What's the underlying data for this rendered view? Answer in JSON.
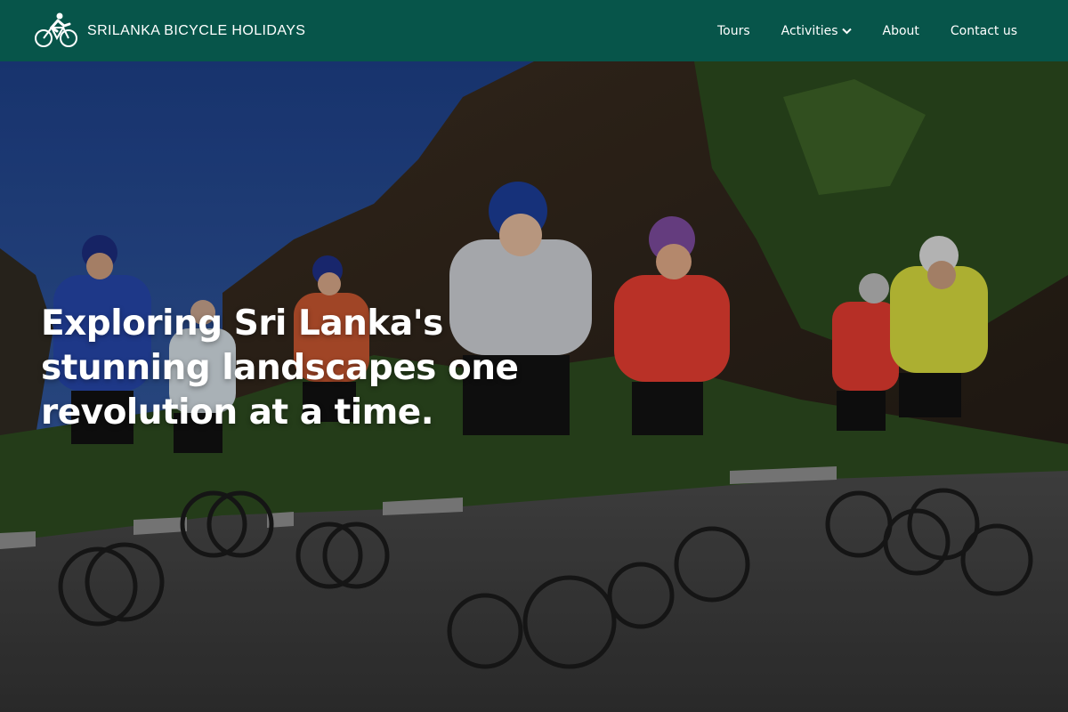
{
  "header": {
    "brand_name": "SRILANKA BICYCLE HOLIDAYS",
    "logo_icon": "cyclist-logo-icon",
    "background_color": "#07554a"
  },
  "nav": {
    "items": [
      {
        "label": "Tours"
      },
      {
        "label": "Activities",
        "icon": "chevron-down-icon"
      },
      {
        "label": "About"
      },
      {
        "label": "Contact us"
      }
    ]
  },
  "hero": {
    "headline": "Exploring Sri Lanka's stunning landscapes one revolution at a time.",
    "image": "photo of a group of cyclists riding mountain bikes on a road below a forested cliff"
  }
}
